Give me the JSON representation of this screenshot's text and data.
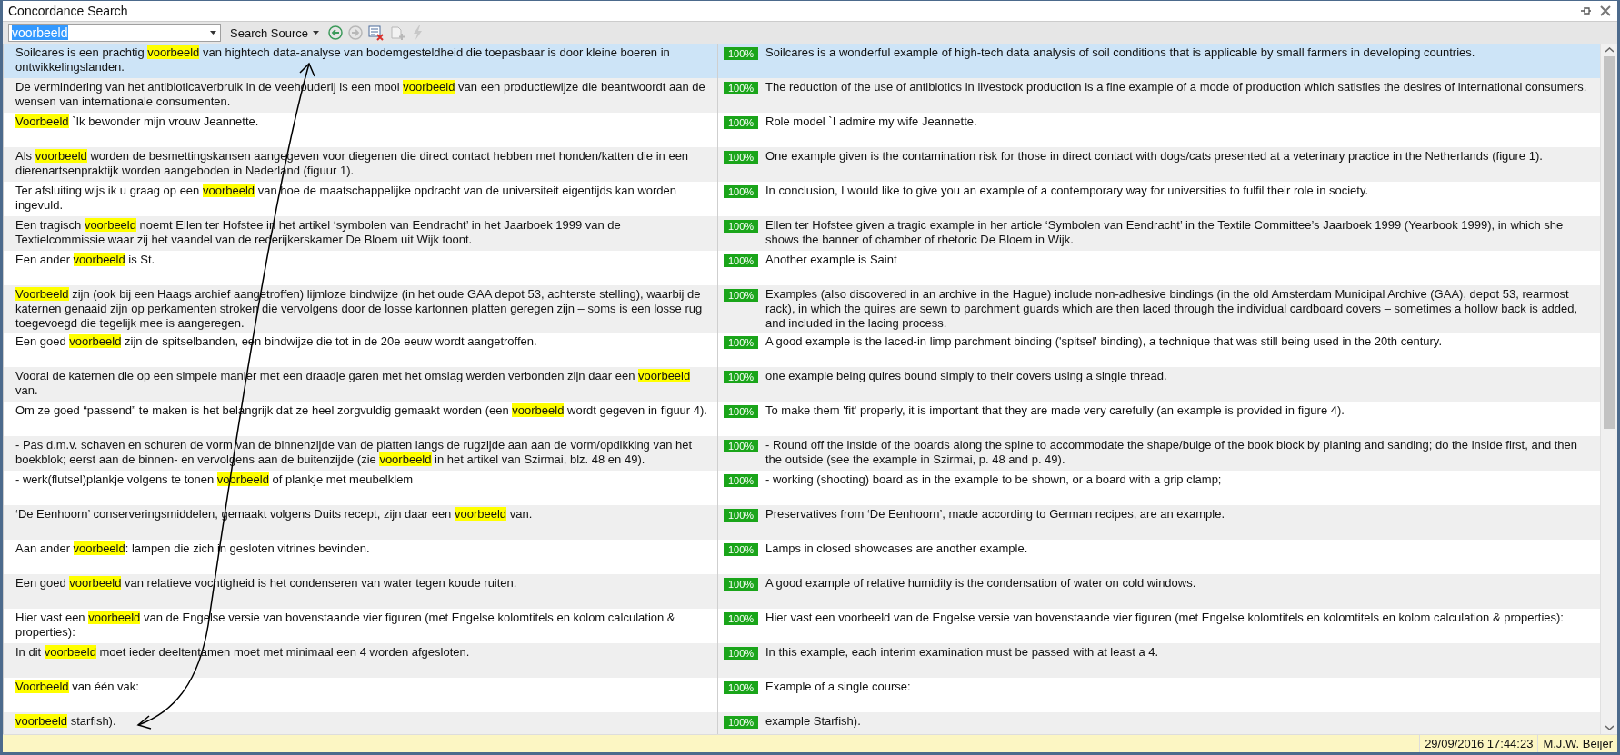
{
  "window": {
    "title": "Concordance Search"
  },
  "toolbar": {
    "search": {
      "value": "voorbeeld"
    },
    "scope": {
      "label": "Search Source"
    },
    "buttons": [
      {
        "kind": "back",
        "disabled": false
      },
      {
        "kind": "forward",
        "disabled": true
      },
      {
        "kind": "clear",
        "disabled": false
      },
      {
        "kind": "add",
        "disabled": true
      },
      {
        "kind": "apply",
        "disabled": true
      }
    ]
  },
  "results": [
    {
      "selected": true,
      "source": [
        {
          "text": "Soilcares is een prachtig ",
          "hit": false
        },
        {
          "text": "voorbeeld",
          "hit": true
        },
        {
          "text": " van hightech data-analyse van bodemgesteldheid die toepasbaar is door kleine boeren in ontwikkelingslanden.",
          "hit": false
        }
      ],
      "match": "100%",
      "target": "Soilcares is a wonderful example of high-tech data analysis of soil conditions that is applicable by small farmers in developing countries."
    },
    {
      "selected": false,
      "source": [
        {
          "text": "De vermindering van het antibioticaverbruik in de veehouderij is een mooi ",
          "hit": false
        },
        {
          "text": "voorbeeld",
          "hit": true
        },
        {
          "text": " van een productiewijze die beantwoordt aan de wensen van internationale consumenten.",
          "hit": false
        }
      ],
      "match": "100%",
      "target": "The reduction of the use of antibiotics in livestock production is a fine example of a mode of production which satisfies the desires of international consumers."
    },
    {
      "selected": false,
      "source": [
        {
          "text": "Voorbeeld",
          "hit": true
        },
        {
          "text": " `Ik bewonder mijn vrouw Jeannette.",
          "hit": false
        }
      ],
      "match": "100%",
      "target": "Role model `I admire my wife Jeannette."
    },
    {
      "selected": false,
      "source": [
        {
          "text": "Als ",
          "hit": false
        },
        {
          "text": "voorbeeld",
          "hit": true
        },
        {
          "text": " worden de besmettingskansen aangegeven voor diegenen die direct contact hebben met honden/katten die in een dierenartsenpraktijk worden aangeboden in Nederland (figuur 1).",
          "hit": false
        }
      ],
      "match": "100%",
      "target": "One example given is the contamination risk for those in direct contact with dogs/cats presented at a veterinary practice in the Netherlands (figure 1)."
    },
    {
      "selected": false,
      "source": [
        {
          "text": "Ter afsluiting wijs ik u graag op een ",
          "hit": false
        },
        {
          "text": "voorbeeld",
          "hit": true
        },
        {
          "text": " van hoe de maatschappelijke opdracht van de universiteit eigentijds kan worden ingevuld.",
          "hit": false
        }
      ],
      "match": "100%",
      "target": "In conclusion, I would like to give you an example of a contemporary way for universities to fulfil their role in society."
    },
    {
      "selected": false,
      "source": [
        {
          "text": "Een tragisch ",
          "hit": false
        },
        {
          "text": "voorbeeld",
          "hit": true
        },
        {
          "text": " noemt Ellen ter Hofstee in het artikel ‘symbolen van Eendracht’ in het Jaarboek 1999 van de Textielcommissie waar zij het vaandel van de rederijkerskamer De Bloem uit Wijk toont.",
          "hit": false
        }
      ],
      "match": "100%",
      "target": "Ellen ter Hofstee given a tragic example in her article ‘Symbolen van Eendracht’ in the Textile Committee’s Jaarboek 1999 (Yearbook 1999), in which she shows the banner of chamber of rhetoric De Bloem in Wijk."
    },
    {
      "selected": false,
      "source": [
        {
          "text": "Een ander ",
          "hit": false
        },
        {
          "text": "voorbeeld",
          "hit": true
        },
        {
          "text": " is St.",
          "hit": false
        }
      ],
      "match": "100%",
      "target": "Another example is Saint"
    },
    {
      "selected": false,
      "source": [
        {
          "text": "Voorbeeld",
          "hit": true
        },
        {
          "text": " zijn (ook bij een Haags archief aangetroffen) lijmloze bindwijze (in het oude GAA depot 53, achterste stelling), waarbij de katernen genaaid zijn op perkamenten stroken die vervolgens door de losse kartonnen platten geregen zijn – soms is een losse rug toegevoegd die tegelijk mee is aangeregen.",
          "hit": false
        }
      ],
      "match": "100%",
      "target": "Examples (also discovered in an archive in the Hague) include non-adhesive bindings (in the old Amsterdam Municipal Archive (GAA), depot 53, rearmost rack), in which the quires are sewn to parchment guards which are then laced through the individual cardboard covers – sometimes a hollow back is added, and included in the lacing process."
    },
    {
      "selected": false,
      "source": [
        {
          "text": "Een goed ",
          "hit": false
        },
        {
          "text": "voorbeeld",
          "hit": true
        },
        {
          "text": " zijn de spitselbanden, een bindwijze die tot in de 20e eeuw wordt aangetroffen.",
          "hit": false
        }
      ],
      "match": "100%",
      "target": "A good example is the laced-in limp parchment binding ('spitsel' binding), a technique that was still being used in the 20th century."
    },
    {
      "selected": false,
      "source": [
        {
          "text": "Vooral de katernen die op een simpele manier met een draadje garen met het omslag werden verbonden zijn daar een ",
          "hit": false
        },
        {
          "text": "voorbeeld",
          "hit": true
        },
        {
          "text": " van.",
          "hit": false
        }
      ],
      "match": "100%",
      "target": "one example being quires bound simply to their covers using a single thread."
    },
    {
      "selected": false,
      "source": [
        {
          "text": "Om ze goed “passend” te maken is het belangrijk dat ze heel zorgvuldig gemaakt worden (een ",
          "hit": false
        },
        {
          "text": "voorbeeld",
          "hit": true
        },
        {
          "text": " wordt gegeven in figuur 4).",
          "hit": false
        }
      ],
      "match": "100%",
      "target": "To make them 'fit' properly, it is important that they are made very carefully (an example is provided in figure 4)."
    },
    {
      "selected": false,
      "source": [
        {
          "text": "- Pas d.m.v. schaven en schuren de vorm van de binnenzijde van de platten langs de rugzijde aan aan de vorm/opdikking van het boekblok; eerst aan de binnen- en vervolgens aan de buitenzijde (zie ",
          "hit": false
        },
        {
          "text": "voorbeeld",
          "hit": true
        },
        {
          "text": " in het artikel van Szirmai, blz. 48 en 49).",
          "hit": false
        }
      ],
      "match": "100%",
      "target": "- Round off the inside of the boards along the spine to accommodate the shape/bulge of the book block by planing and sanding; do the inside first, and then the outside (see the example in Szirmai, p. 48 and p. 49)."
    },
    {
      "selected": false,
      "source": [
        {
          "text": "- werk(flutsel)plankje volgens te tonen ",
          "hit": false
        },
        {
          "text": "voorbeeld",
          "hit": true
        },
        {
          "text": " of plankje met meubelklem",
          "hit": false
        }
      ],
      "match": "100%",
      "target": "- working (shooting) board as in the example to be shown, or a board with a grip clamp;"
    },
    {
      "selected": false,
      "source": [
        {
          "text": "‘De Eenhoorn’ conserveringsmiddelen, gemaakt volgens Duits recept, zijn daar een ",
          "hit": false
        },
        {
          "text": "voorbeeld",
          "hit": true
        },
        {
          "text": " van.",
          "hit": false
        }
      ],
      "match": "100%",
      "target": "Preservatives from ‘De Eenhoorn’, made according to German recipes, are an example."
    },
    {
      "selected": false,
      "source": [
        {
          "text": "Aan ander ",
          "hit": false
        },
        {
          "text": "voorbeeld",
          "hit": true
        },
        {
          "text": ": lampen die zich in gesloten vitrines bevinden.",
          "hit": false
        }
      ],
      "match": "100%",
      "target": "Lamps in closed showcases are another example."
    },
    {
      "selected": false,
      "source": [
        {
          "text": "Een goed ",
          "hit": false
        },
        {
          "text": "voorbeeld",
          "hit": true
        },
        {
          "text": " van relatieve vochtigheid is het condenseren van water tegen koude ruiten.",
          "hit": false
        }
      ],
      "match": "100%",
      "target": "A good example of relative humidity is the condensation of water on cold windows."
    },
    {
      "selected": false,
      "source": [
        {
          "text": "Hier vast een ",
          "hit": false
        },
        {
          "text": "voorbeeld",
          "hit": true
        },
        {
          "text": " van de Engelse versie van bovenstaande vier figuren (met Engelse kolomtitels en kolom calculation & properties):",
          "hit": false
        }
      ],
      "match": "100%",
      "target": "Hier vast een voorbeeld van de Engelse versie van bovenstaande vier figuren (met Engelse kolomtitels en kolomtitels en kolom calculation & properties):"
    },
    {
      "selected": false,
      "source": [
        {
          "text": "In dit ",
          "hit": false
        },
        {
          "text": "voorbeeld",
          "hit": true
        },
        {
          "text": " moet ieder deeltentamen moet met minimaal een 4 worden afgesloten.",
          "hit": false
        }
      ],
      "match": "100%",
      "target": "In this example, each interim examination must be passed with at least a 4."
    },
    {
      "selected": false,
      "source": [
        {
          "text": "Voorbeeld",
          "hit": true
        },
        {
          "text": " van één vak:",
          "hit": false
        }
      ],
      "match": "100%",
      "target": "Example of a single course:"
    },
    {
      "selected": false,
      "source": [
        {
          "text": "voorbeeld",
          "hit": true
        },
        {
          "text": " starfish).",
          "hit": false
        }
      ],
      "match": "100%",
      "target": "example Starfish)."
    }
  ],
  "status_bar": {
    "date": "29/09/2016 17:44:23",
    "user": "M.J.W. Beijer"
  }
}
